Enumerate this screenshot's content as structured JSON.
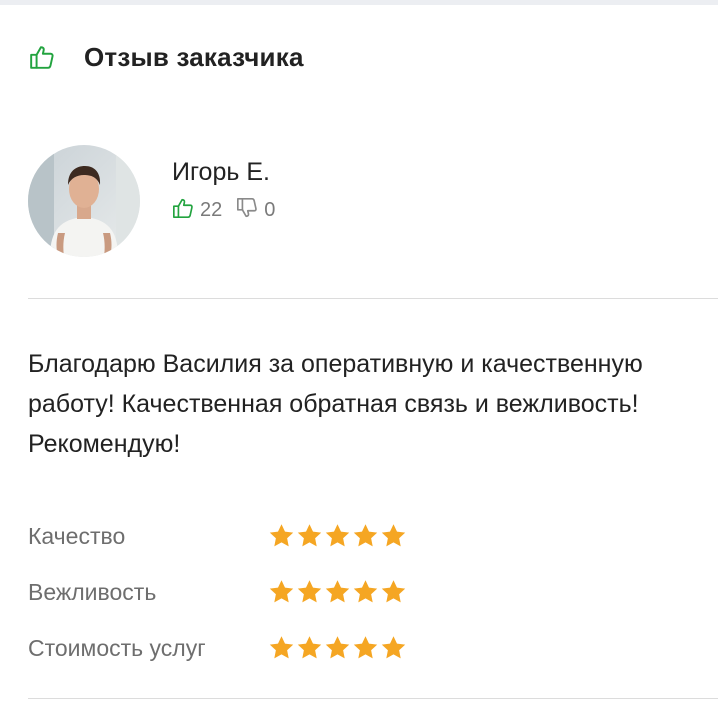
{
  "header": {
    "title": "Отзыв заказчика",
    "icon": "thumbs-up-icon"
  },
  "reviewer": {
    "name": "Игорь Е.",
    "likes": "22",
    "dislikes": "0"
  },
  "review": {
    "text": "Благодарю Василия за оперативную и качественную работу! Качественная обратная связь и вежливость! Рекомендую!"
  },
  "ratings": [
    {
      "label": "Качество",
      "stars": 5,
      "max": 5
    },
    {
      "label": "Вежливость",
      "stars": 5,
      "max": 5
    },
    {
      "label": "Стоимость услуг",
      "stars": 5,
      "max": 5
    }
  ],
  "colors": {
    "accent_green": "#22a33f",
    "star": "#f5a623",
    "muted_text": "#6e6e6e"
  }
}
